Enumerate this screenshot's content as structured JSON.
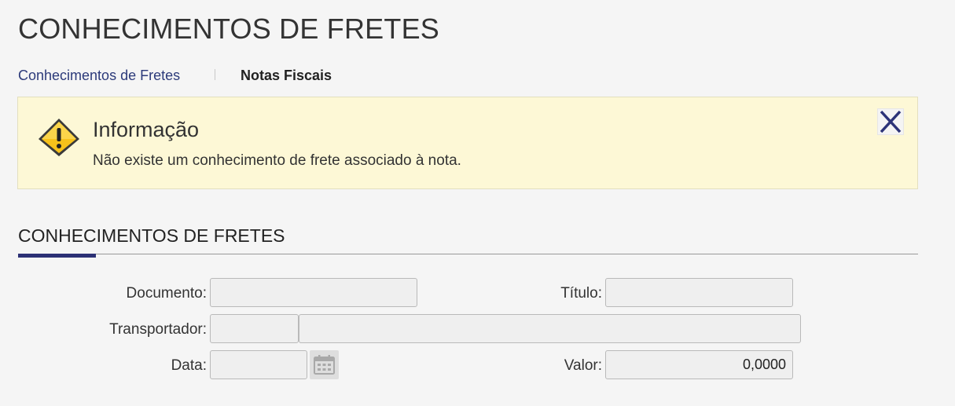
{
  "page": {
    "title": "CONHECIMENTOS DE FRETES"
  },
  "tabs": [
    {
      "label": "Conhecimentos de Fretes",
      "active": false
    },
    {
      "label": "Notas Fiscais",
      "active": true
    }
  ],
  "alert": {
    "title": "Informação",
    "message": "Não existe um conhecimento de frete associado à nota.",
    "icon": "warning-icon",
    "close_icon": "close-icon"
  },
  "section": {
    "title": "CONHECIMENTOS DE FRETES"
  },
  "form": {
    "documento": {
      "label": "Documento:",
      "value": ""
    },
    "titulo": {
      "label": "Título:",
      "value": ""
    },
    "transportador": {
      "label": "Transportador:",
      "code": "",
      "name": ""
    },
    "data": {
      "label": "Data:",
      "value": "",
      "icon": "calendar-icon"
    },
    "valor": {
      "label": "Valor:",
      "value": "0,0000"
    }
  },
  "colors": {
    "accent": "#2c3175",
    "link": "#2c3a7a",
    "alert_bg": "#fdf8d6"
  }
}
